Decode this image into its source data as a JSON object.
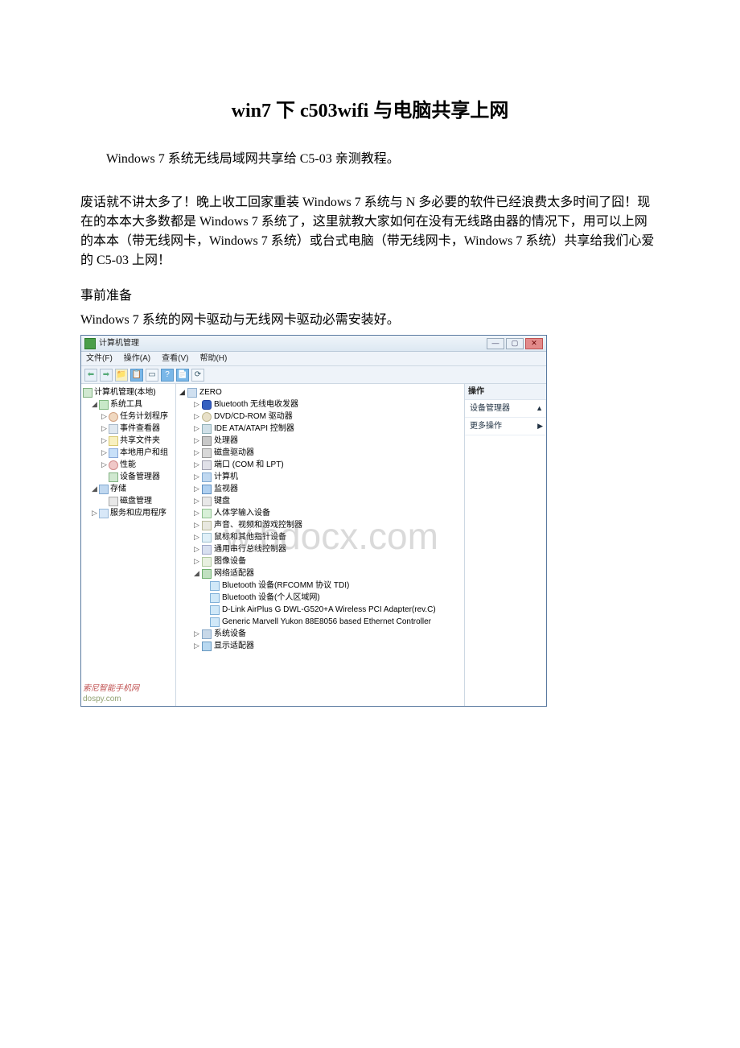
{
  "title": "win7 下 c503wifi 与电脑共享上网",
  "intro": "Windows 7 系统无线局域网共享给 C5-03 亲测教程。",
  "body": "废话就不讲太多了！晚上收工回家重装 Windows 7 系统与 N 多必要的软件已经浪费太多时间了囧！现在的本本大多数都是 Windows 7 系统了，这里就教大家如何在没有无线路由器的情况下，用可以上网的本本（带无线网卡，Windows 7 系统）或台式电脑（带无线网卡，Windows 7 系统）共享给我们心爱的 C5-03 上网！",
  "prep_title": "事前准备",
  "prep_line": "Windows 7 系统的网卡驱动与无线网卡驱动必需安装好。",
  "window": {
    "title": "计算机管理",
    "menus": [
      "文件(F)",
      "操作(A)",
      "查看(V)",
      "帮助(H)"
    ],
    "leftHeader": "计算机管理(本地)",
    "leftTree": [
      {
        "exp": "◢",
        "icon": "tool",
        "label": "系统工具",
        "ind": 1
      },
      {
        "exp": "▷",
        "icon": "clock",
        "label": "任务计划程序",
        "ind": 2
      },
      {
        "exp": "▷",
        "icon": "log",
        "label": "事件查看器",
        "ind": 2
      },
      {
        "exp": "▷",
        "icon": "share",
        "label": "共享文件夹",
        "ind": 2
      },
      {
        "exp": "▷",
        "icon": "users",
        "label": "本地用户和组",
        "ind": 2
      },
      {
        "exp": "▷",
        "icon": "perf",
        "label": "性能",
        "ind": 2
      },
      {
        "exp": "",
        "icon": "dev",
        "label": "设备管理器",
        "ind": 2
      },
      {
        "exp": "◢",
        "icon": "storage",
        "label": "存储",
        "ind": 1
      },
      {
        "exp": "",
        "icon": "disk",
        "label": "磁盘管理",
        "ind": 2
      },
      {
        "exp": "▷",
        "icon": "svc",
        "label": "服务和应用程序",
        "ind": 1
      }
    ],
    "midRoot": "ZERO",
    "devices": [
      {
        "exp": "▷",
        "icon": "bt",
        "label": "Bluetooth 无线电收发器"
      },
      {
        "exp": "▷",
        "icon": "dvd",
        "label": "DVD/CD-ROM 驱动器"
      },
      {
        "exp": "▷",
        "icon": "ide",
        "label": "IDE ATA/ATAPI 控制器"
      },
      {
        "exp": "▷",
        "icon": "cpu",
        "label": "处理器"
      },
      {
        "exp": "▷",
        "icon": "hdd",
        "label": "磁盘驱动器"
      },
      {
        "exp": "▷",
        "icon": "port",
        "label": "端口 (COM 和 LPT)"
      },
      {
        "exp": "▷",
        "icon": "pc",
        "label": "计算机"
      },
      {
        "exp": "▷",
        "icon": "mon",
        "label": "监视器"
      },
      {
        "exp": "▷",
        "icon": "kb",
        "label": "键盘"
      },
      {
        "exp": "▷",
        "icon": "hid",
        "label": "人体学输入设备"
      },
      {
        "exp": "▷",
        "icon": "snd",
        "label": "声音、视频和游戏控制器"
      },
      {
        "exp": "▷",
        "icon": "mouse",
        "label": "鼠标和其他指针设备"
      },
      {
        "exp": "▷",
        "icon": "usb",
        "label": "通用串行总线控制器"
      },
      {
        "exp": "▷",
        "icon": "img",
        "label": "图像设备"
      },
      {
        "exp": "◢",
        "icon": "net",
        "label": "网络适配器"
      }
    ],
    "netSub": [
      {
        "icon": "netadp",
        "label": "Bluetooth 设备(RFCOMM 协议 TDI)"
      },
      {
        "icon": "netadp",
        "label": "Bluetooth 设备(个人区域网)"
      },
      {
        "icon": "netadp",
        "label": "D-Link AirPlus G DWL-G520+A Wireless PCI Adapter(rev.C)"
      },
      {
        "icon": "netadp",
        "label": "Generic Marvell Yukon 88E8056 based Ethernet Controller"
      }
    ],
    "devicesTail": [
      {
        "exp": "▷",
        "icon": "sys",
        "label": "系统设备"
      },
      {
        "exp": "▷",
        "icon": "disp",
        "label": "显示适配器"
      }
    ],
    "rightHdr": "操作",
    "rightSub1": "设备管理器",
    "rightSub2": "更多操作",
    "watermark": "w.bdocx.com",
    "logo1": "索尼智能手机网",
    "logo2": "dospy.com"
  }
}
